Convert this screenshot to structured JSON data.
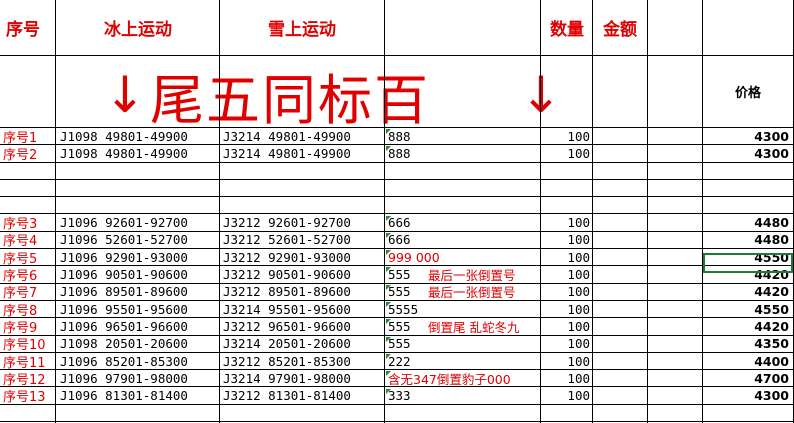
{
  "header": {
    "seq": "序号",
    "ice": "冰上运动",
    "snow": "雪上运动",
    "qty": "数量",
    "amount": "金额"
  },
  "banner": {
    "text": "尾五同标百",
    "left_arrow": "↓",
    "right_arrow": "↓",
    "price_label": "价格"
  },
  "rows": [
    {
      "seq": "序号1",
      "ice": "J1098  49801-49900",
      "snow": "J3214  49801-49900",
      "note": "888",
      "note_extra": "",
      "qty": "100",
      "price": "4300"
    },
    {
      "seq": "序号2",
      "ice": "J1098  49801-49900",
      "snow": "J3214  49801-49900",
      "note": "888",
      "note_extra": "",
      "qty": "100",
      "price": "4300"
    },
    {
      "seq": "序号3",
      "ice": "J1096  92601-92700",
      "snow": "J3212  92601-92700",
      "note": "666",
      "note_extra": "",
      "qty": "100",
      "price": "4480"
    },
    {
      "seq": "序号4",
      "ice": "J1096  52601-52700",
      "snow": "J3212  52601-52700",
      "note": "666",
      "note_extra": "",
      "qty": "100",
      "price": "4480"
    },
    {
      "seq": "序号5",
      "ice": "J1096  92901-93000",
      "snow": "J3212  92901-93000",
      "note": "999   000",
      "note_extra": "",
      "qty": "100",
      "price": "4550"
    },
    {
      "seq": "序号6",
      "ice": "J1096  90501-90600",
      "snow": "J3212  90501-90600",
      "note": "555",
      "note_extra": "最后一张倒置号",
      "qty": "100",
      "price": "4420"
    },
    {
      "seq": "序号7",
      "ice": "J1096  89501-89600",
      "snow": "J3212  89501-89600",
      "note": "555",
      "note_extra": "最后一张倒置号",
      "qty": "100",
      "price": "4420"
    },
    {
      "seq": "序号8",
      "ice": "J1096  95501-95600",
      "snow": "J3214  95501-95600",
      "note": "5555",
      "note_extra": "",
      "qty": "100",
      "price": "4550"
    },
    {
      "seq": "序号9",
      "ice": "J1096  96501-96600",
      "snow": "J3212  96501-96600",
      "note": "555",
      "note_extra": "倒置尾  乱蛇冬九",
      "qty": "100",
      "price": "4420"
    },
    {
      "seq": "序号10",
      "ice": "J1098  20501-20600",
      "snow": "J3214  20501-20600",
      "note": "555",
      "note_extra": "",
      "qty": "100",
      "price": "4350"
    },
    {
      "seq": "序号11",
      "ice": "J1096  85201-85300",
      "snow": "J3212  85201-85300",
      "note": "222",
      "note_extra": "",
      "qty": "100",
      "price": "4400"
    },
    {
      "seq": "序号12",
      "ice": "J1096  97901-98000",
      "snow": "J3214  97901-98000",
      "note": "含无347倒置豹子000",
      "note_extra": "",
      "qty": "100",
      "price": "4700"
    },
    {
      "seq": "序号13",
      "ice": "J1096  81301-81400",
      "snow": "J3212  81301-81400",
      "note": "333",
      "note_extra": "",
      "qty": "100",
      "price": "4300"
    }
  ],
  "colors": {
    "red": "#e00000",
    "grid": "#000000",
    "selection": "#1f7a3a"
  }
}
